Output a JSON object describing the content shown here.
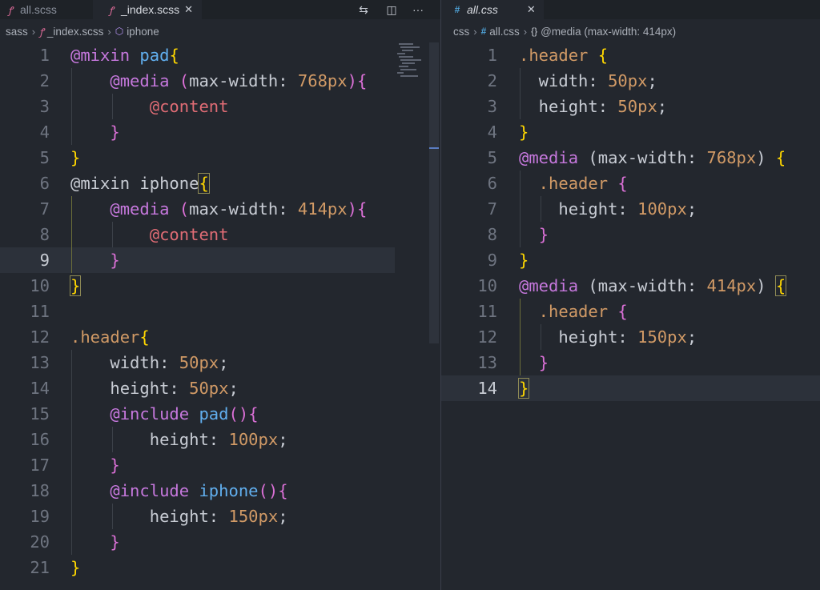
{
  "left_editor": {
    "tabs": [
      {
        "label": "all.scss",
        "icon": "sass-file-icon",
        "active": false
      },
      {
        "label": "_index.scss",
        "icon": "sass-file-icon",
        "active": true,
        "close": "✕"
      }
    ],
    "actions": [
      {
        "name": "open-changes-icon",
        "glyph": "⇆"
      },
      {
        "name": "split-editor-icon",
        "glyph": "◫"
      },
      {
        "name": "more-actions-icon",
        "glyph": "···"
      }
    ],
    "breadcrumb": [
      "sass",
      "_index.scss",
      "iphone"
    ],
    "lines": [
      [
        [
          "@mixin ",
          "t-at"
        ],
        [
          "pad",
          "t-fn"
        ],
        [
          "{",
          "t-b1"
        ]
      ],
      [
        [
          "    "
        ],
        [
          "@media ",
          "t-at"
        ],
        [
          "(",
          "t-b2"
        ],
        [
          "max-width: ",
          "t-prop"
        ],
        [
          "768px",
          "t-num"
        ],
        [
          ")",
          "t-b2"
        ],
        [
          "{",
          "t-b2"
        ]
      ],
      [
        [
          "        "
        ],
        [
          "@content",
          "t-var"
        ]
      ],
      [
        [
          "    "
        ],
        [
          "}",
          "t-b2"
        ]
      ],
      [
        [
          "}",
          "t-b1"
        ]
      ],
      [
        [
          "@mixin iphone",
          "t-plain"
        ],
        [
          "{",
          "t-b1 box"
        ]
      ],
      [
        [
          "    "
        ],
        [
          "@media ",
          "t-at"
        ],
        [
          "(",
          "t-b2"
        ],
        [
          "max-width: ",
          "t-prop"
        ],
        [
          "414px",
          "t-num"
        ],
        [
          ")",
          "t-b2"
        ],
        [
          "{",
          "t-b2"
        ]
      ],
      [
        [
          "        "
        ],
        [
          "@content",
          "t-var"
        ]
      ],
      [
        [
          "    "
        ],
        [
          "}",
          "t-b2"
        ]
      ],
      [
        [
          "}",
          "t-b1 box"
        ]
      ],
      [],
      [
        [
          ".header",
          "t-sel"
        ],
        [
          "{",
          "t-b1"
        ]
      ],
      [
        [
          "    width: ",
          "t-prop"
        ],
        [
          "50px",
          "t-num"
        ],
        [
          ";",
          "t-plain"
        ]
      ],
      [
        [
          "    height: ",
          "t-prop"
        ],
        [
          "50px",
          "t-num"
        ],
        [
          ";",
          "t-plain"
        ]
      ],
      [
        [
          "    "
        ],
        [
          "@include ",
          "t-at"
        ],
        [
          "pad",
          "t-fn"
        ],
        [
          "()",
          "t-b2"
        ],
        [
          "{",
          "t-b2"
        ]
      ],
      [
        [
          "        height: ",
          "t-prop"
        ],
        [
          "100px",
          "t-num"
        ],
        [
          ";",
          "t-plain"
        ]
      ],
      [
        [
          "    "
        ],
        [
          "}",
          "t-b2"
        ]
      ],
      [
        [
          "    "
        ],
        [
          "@include ",
          "t-at"
        ],
        [
          "iphone",
          "t-fn"
        ],
        [
          "()",
          "t-b2"
        ],
        [
          "{",
          "t-b2"
        ]
      ],
      [
        [
          "        height: ",
          "t-prop"
        ],
        [
          "150px",
          "t-num"
        ],
        [
          ";",
          "t-plain"
        ]
      ],
      [
        [
          "    "
        ],
        [
          "}",
          "t-b2"
        ]
      ],
      [
        [
          "}",
          "t-b1"
        ]
      ]
    ]
  },
  "right_editor": {
    "tabs": [
      {
        "label": "all.css",
        "icon": "css-file-icon",
        "active": true,
        "close": "✕"
      }
    ],
    "breadcrumb": [
      "css",
      "all.css",
      "@media (max-width: 414px)"
    ],
    "lines": [
      [
        [
          ".header ",
          "t-sel"
        ],
        [
          "{",
          "t-b1"
        ]
      ],
      [
        [
          "  width: ",
          "t-prop"
        ],
        [
          "50px",
          "t-num"
        ],
        [
          ";",
          "t-plain"
        ]
      ],
      [
        [
          "  height: ",
          "t-prop"
        ],
        [
          "50px",
          "t-num"
        ],
        [
          ";",
          "t-plain"
        ]
      ],
      [
        [
          "}",
          "t-b1"
        ]
      ],
      [
        [
          "@media ",
          "t-at"
        ],
        [
          "(max-width: ",
          "t-prop"
        ],
        [
          "768px",
          "t-num"
        ],
        [
          ") ",
          "t-prop"
        ],
        [
          "{",
          "t-b1"
        ]
      ],
      [
        [
          "  .header ",
          "t-sel"
        ],
        [
          "{",
          "t-b2"
        ]
      ],
      [
        [
          "    height: ",
          "t-prop"
        ],
        [
          "100px",
          "t-num"
        ],
        [
          ";",
          "t-plain"
        ]
      ],
      [
        [
          "  "
        ],
        [
          "}",
          "t-b2"
        ]
      ],
      [
        [
          "}",
          "t-b1"
        ]
      ],
      [
        [
          "@media ",
          "t-at"
        ],
        [
          "(max-width: ",
          "t-prop"
        ],
        [
          "414px",
          "t-num"
        ],
        [
          ") ",
          "t-prop"
        ],
        [
          "{",
          "t-b1 box"
        ]
      ],
      [
        [
          "  .header ",
          "t-sel"
        ],
        [
          "{",
          "t-b2"
        ]
      ],
      [
        [
          "    height: ",
          "t-prop"
        ],
        [
          "150px",
          "t-num"
        ],
        [
          ";",
          "t-plain"
        ]
      ],
      [
        [
          "  "
        ],
        [
          "}",
          "t-b2"
        ]
      ],
      [
        [
          "}",
          "t-b1 box"
        ]
      ]
    ]
  }
}
